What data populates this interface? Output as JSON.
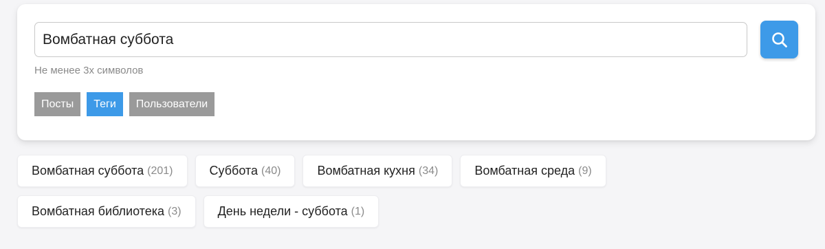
{
  "search": {
    "value": "Вомбатная суббота",
    "hint": "Не менее 3х символов",
    "button_icon": "search-icon"
  },
  "filters": {
    "tabs": [
      {
        "label": "Посты",
        "active": false
      },
      {
        "label": "Теги",
        "active": true
      },
      {
        "label": "Пользователи",
        "active": false
      }
    ]
  },
  "results": {
    "tags": [
      {
        "name": "Вомбатная суббота",
        "count": "(201)"
      },
      {
        "name": "Суббота",
        "count": "(40)"
      },
      {
        "name": "Вомбатная кухня",
        "count": "(34)"
      },
      {
        "name": "Вомбатная среда",
        "count": "(9)"
      },
      {
        "name": "Вомбатная библиотека",
        "count": "(3)"
      },
      {
        "name": "День недели - суббота",
        "count": "(1)"
      }
    ]
  },
  "colors": {
    "accent": "#3d9ae8",
    "inactive_tab": "#9a9a9a",
    "background": "#f5f5f7"
  }
}
